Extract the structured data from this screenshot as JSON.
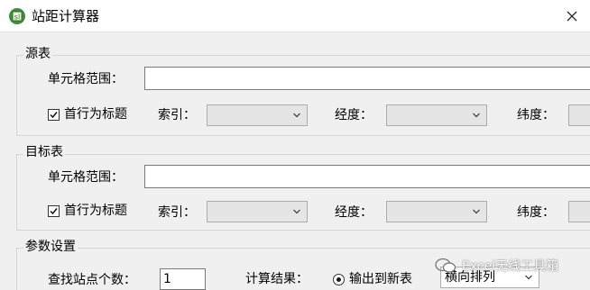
{
  "window": {
    "title": "站距计算器",
    "close_glyph": "✕"
  },
  "source": {
    "group_title": "源表",
    "range_label": "单元格范围：",
    "range_value": "",
    "header_checkbox_label": "首行为标题",
    "header_checked": true,
    "index_label": "索引：",
    "lon_label": "经度：",
    "lat_label": "纬度："
  },
  "target": {
    "group_title": "目标表",
    "range_label": "单元格范围：",
    "range_value": "",
    "header_checkbox_label": "首行为标题",
    "header_checked": true,
    "index_label": "索引：",
    "lon_label": "经度：",
    "lat_label": "纬度："
  },
  "params": {
    "group_title": "参数设置",
    "count_label": "查找站点个数：",
    "count_value": "1",
    "result_label": "计算结果：",
    "output_radio_label": "输出到新表",
    "output_selected": true,
    "arrange_value": "横向排列"
  },
  "watermark": {
    "text": "Excel无线工具箱"
  },
  "colors": {
    "window_bg": "#f0f0f0",
    "titlebar_bg": "#ffffff",
    "icon_green": "#3f8f3a"
  }
}
